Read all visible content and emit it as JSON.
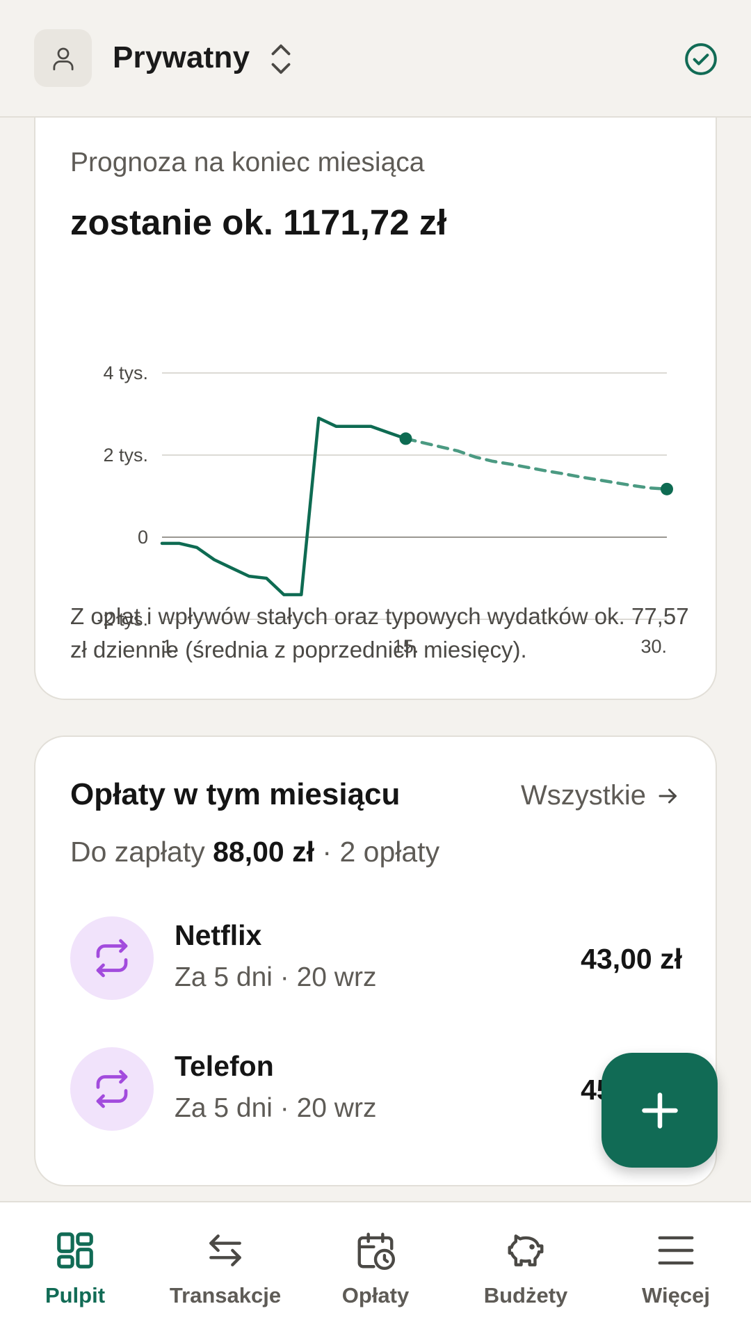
{
  "header": {
    "account_name": "Prywatny",
    "icons": [
      "user-icon",
      "chevron-up-down-icon",
      "check-circle-icon"
    ]
  },
  "forecast": {
    "label": "Prognoza na koniec miesiąca",
    "value": "zostanie ok. 1171,72 zł",
    "note": "Z opłat i wpływów stałych oraz typowych wydatków ok. 77,57 zł dziennie (średnia z poprzednich miesięcy)."
  },
  "chart_data": {
    "type": "line",
    "y_ticks": [
      {
        "value": 4000,
        "label": "4 tys."
      },
      {
        "value": 2000,
        "label": "2 tys."
      },
      {
        "value": 0,
        "label": "0"
      },
      {
        "value": -2000,
        "label": "-2 tys."
      }
    ],
    "x_ticks": [
      {
        "value": 1,
        "label": "1."
      },
      {
        "value": 15,
        "label": "15."
      },
      {
        "value": 30,
        "label": "30."
      }
    ],
    "xlim": [
      1,
      30
    ],
    "ylim": [
      -2000,
      4000
    ],
    "grid": true,
    "series": [
      {
        "style": "solid",
        "color": "#0e6b52",
        "points": [
          [
            1,
            -150
          ],
          [
            2,
            -150
          ],
          [
            3,
            -250
          ],
          [
            4,
            -550
          ],
          [
            5,
            -750
          ],
          [
            6,
            -950
          ],
          [
            7,
            -1000
          ],
          [
            8,
            -1400
          ],
          [
            9,
            -1400
          ],
          [
            10,
            2900
          ],
          [
            11,
            2700
          ],
          [
            12,
            2700
          ],
          [
            13,
            2700
          ],
          [
            14,
            2550
          ],
          [
            15,
            2400
          ]
        ]
      },
      {
        "style": "dashed",
        "color": "#4b9a82",
        "points": [
          [
            15,
            2400
          ],
          [
            16,
            2300
          ],
          [
            17,
            2200
          ],
          [
            18,
            2100
          ],
          [
            19,
            1950
          ],
          [
            20,
            1850
          ],
          [
            21,
            1780
          ],
          [
            22,
            1700
          ],
          [
            23,
            1620
          ],
          [
            24,
            1550
          ],
          [
            25,
            1470
          ],
          [
            26,
            1400
          ],
          [
            27,
            1330
          ],
          [
            28,
            1260
          ],
          [
            29,
            1200
          ],
          [
            30,
            1171.72
          ]
        ]
      }
    ],
    "markers": [
      [
        15,
        2400
      ],
      [
        30,
        1171.72
      ]
    ]
  },
  "bills": {
    "title": "Opłaty w tym miesiącu",
    "all_label": "Wszystkie",
    "summary_prefix": "Do zapłaty",
    "summary_amount": "88,00 zł",
    "summary_suffix": "· 2 opłaty",
    "items": [
      {
        "name": "Netflix",
        "when": "Za 5 dni · 20 wrz",
        "amount": "43,00 zł",
        "icon": "repeat-icon"
      },
      {
        "name": "Telefon",
        "when": "Za 5 dni · 20 wrz",
        "amount": "45,00 zł",
        "icon": "repeat-icon"
      }
    ]
  },
  "fab": {
    "icon": "plus-icon"
  },
  "nav": {
    "items": [
      {
        "label": "Pulpit",
        "icon": "dashboard-icon",
        "active": true
      },
      {
        "label": "Transakcje",
        "icon": "transfer-arrows-icon",
        "active": false
      },
      {
        "label": "Opłaty",
        "icon": "calendar-clock-icon",
        "active": false
      },
      {
        "label": "Budżety",
        "icon": "piggy-bank-icon",
        "active": false
      },
      {
        "label": "Więcej",
        "icon": "menu-icon",
        "active": false
      }
    ]
  },
  "colors": {
    "accent": "#116b55",
    "background": "#f4f2ee",
    "card": "#ffffff",
    "bill_icon_bg": "#f1e3fb",
    "bill_icon": "#a24bdd"
  }
}
